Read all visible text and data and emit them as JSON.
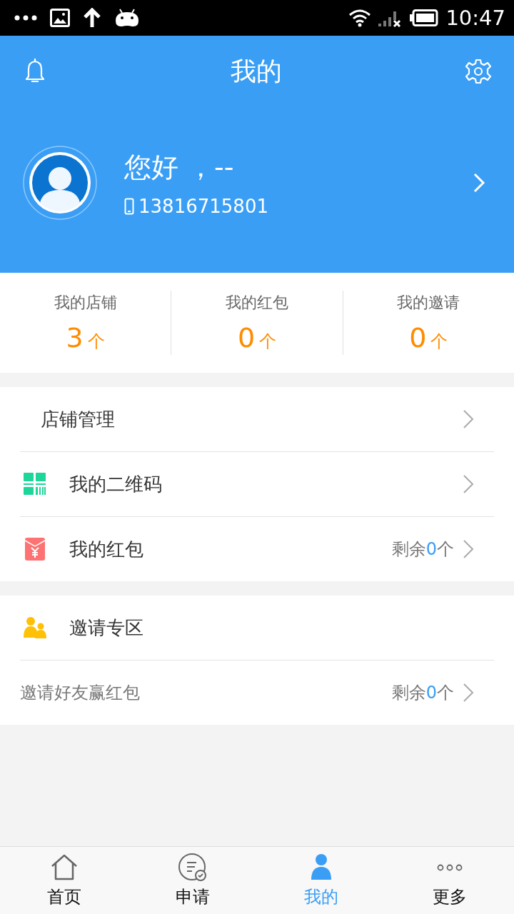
{
  "status_bar": {
    "time": "10:47"
  },
  "header": {
    "title": "我的",
    "greeting": "您好 ，--",
    "phone": "13816715801"
  },
  "stats": [
    {
      "label": "我的店铺",
      "value": "3",
      "unit": "个"
    },
    {
      "label": "我的红包",
      "value": "0",
      "unit": "个"
    },
    {
      "label": "我的邀请",
      "value": "0",
      "unit": "个"
    }
  ],
  "sections": [
    {
      "rows": [
        {
          "kind": "heading",
          "label": "店铺管理",
          "chevron": true
        },
        {
          "kind": "qr",
          "label": "我的二维码",
          "chevron": true
        },
        {
          "kind": "envelope",
          "label": "我的红包",
          "remaining": {
            "prefix": "剩余",
            "count": "0",
            "suffix": "个"
          },
          "chevron": true
        }
      ]
    },
    {
      "rows": [
        {
          "kind": "people",
          "label": "邀请专区",
          "chevron": false
        },
        {
          "kind": "sub",
          "label": "邀请好友赢红包",
          "remaining": {
            "prefix": "剩余",
            "count": "0",
            "suffix": "个"
          },
          "chevron": true
        }
      ]
    }
  ],
  "tabs": [
    {
      "label": "首页",
      "selected": false
    },
    {
      "label": "申请",
      "selected": false
    },
    {
      "label": "我的",
      "selected": true
    },
    {
      "label": "更多",
      "selected": false
    }
  ]
}
